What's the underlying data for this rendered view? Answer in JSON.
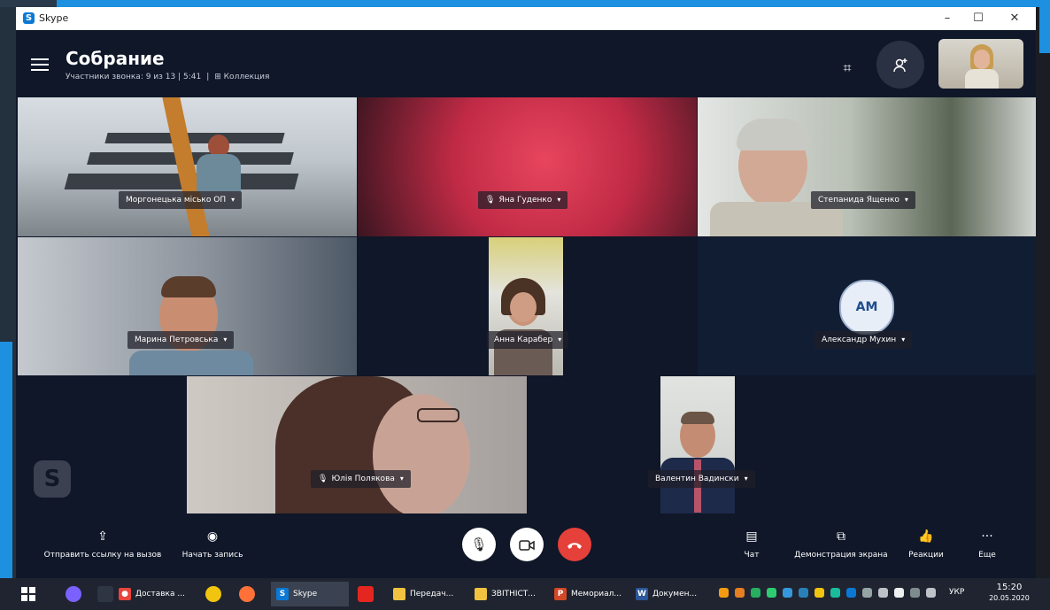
{
  "window": {
    "app_title": "Skype",
    "minimize": "–",
    "maximize": "☐",
    "close": "✕"
  },
  "header": {
    "title": "Собрание",
    "subtitle": "Участники звонка: 9 из 13 | 5:41",
    "subtitle_separator": "|",
    "subtitle_extra": "Коллекция"
  },
  "participants": [
    {
      "name": "Моргонецька місько ОП",
      "muted": false
    },
    {
      "name": "Яна Гуденко",
      "muted": true
    },
    {
      "name": "Степанида Ященко",
      "muted": false
    },
    {
      "name": "Марина Петровська",
      "muted": false
    },
    {
      "name": "Анна Карабер",
      "muted": false
    },
    {
      "name": "Александр Мухин",
      "muted": false,
      "initials": "AM"
    },
    {
      "name": "Юлія Полякова",
      "muted": true
    },
    {
      "name": "Валентин Вадински",
      "muted": false
    }
  ],
  "toolbar": {
    "share_link": "Отправить ссылку на вызов",
    "start_recording": "Начать запись",
    "chat": "Чат",
    "screen_share": "Демонстрация экрана",
    "reactions": "Реакции",
    "more": "Еще"
  },
  "taskbar": {
    "apps": [
      {
        "label": "Доставка ...",
        "icon": "chrome-icon"
      },
      {
        "label": "Skype",
        "icon": "skype-icon",
        "active": true
      },
      {
        "label": "Передач...",
        "icon": "folder-icon"
      },
      {
        "label": "ЗВІТНІСТ...",
        "icon": "folder-icon"
      },
      {
        "label": "Мемориал...",
        "icon": "powerpoint-icon"
      },
      {
        "label": "Докумен...",
        "icon": "word-icon"
      }
    ],
    "language": "УКР",
    "time": "15:20",
    "date": "20.05.2020"
  },
  "colors": {
    "accent": "#0b78d4",
    "end_call": "#e5403a",
    "window_bg": "#0f1729"
  }
}
